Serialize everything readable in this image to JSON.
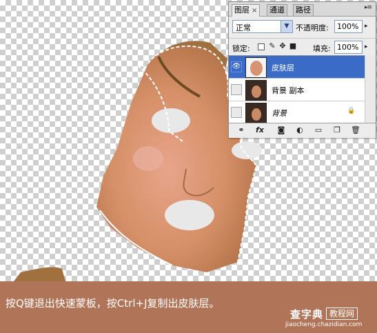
{
  "layers_panel": {
    "tabs": [
      {
        "label": "图层",
        "close": "×"
      },
      {
        "label": "通道"
      },
      {
        "label": "路径"
      }
    ],
    "menu_icon": "panel-menu-icon",
    "blend_mode": "正常",
    "opacity_label": "不透明度:",
    "opacity_value": "100%",
    "lock_label": "锁定:",
    "fill_label": "填充:",
    "fill_value": "100%",
    "layers": [
      {
        "name": "皮肤层",
        "selected": true,
        "visible": true
      },
      {
        "name": "背景 副本",
        "selected": false,
        "visible": false
      },
      {
        "name": "背景",
        "selected": false,
        "visible": false,
        "locked": true
      }
    ],
    "bottom_icons": [
      "link-icon",
      "fx-icon",
      "mask-icon",
      "adjustment-icon",
      "folder-icon",
      "new-layer-icon",
      "trash-icon"
    ]
  },
  "caption": {
    "text": "按Q键退出快速蒙板，按Ctrl+J复制出皮肤层。"
  },
  "watermark": {
    "title": "查字典",
    "subtitle": "教程网",
    "url": "jiaocheng.chazidian.com"
  },
  "colors": {
    "caption_bg": "#b07558",
    "selection_blue": "#3a6bc6"
  }
}
